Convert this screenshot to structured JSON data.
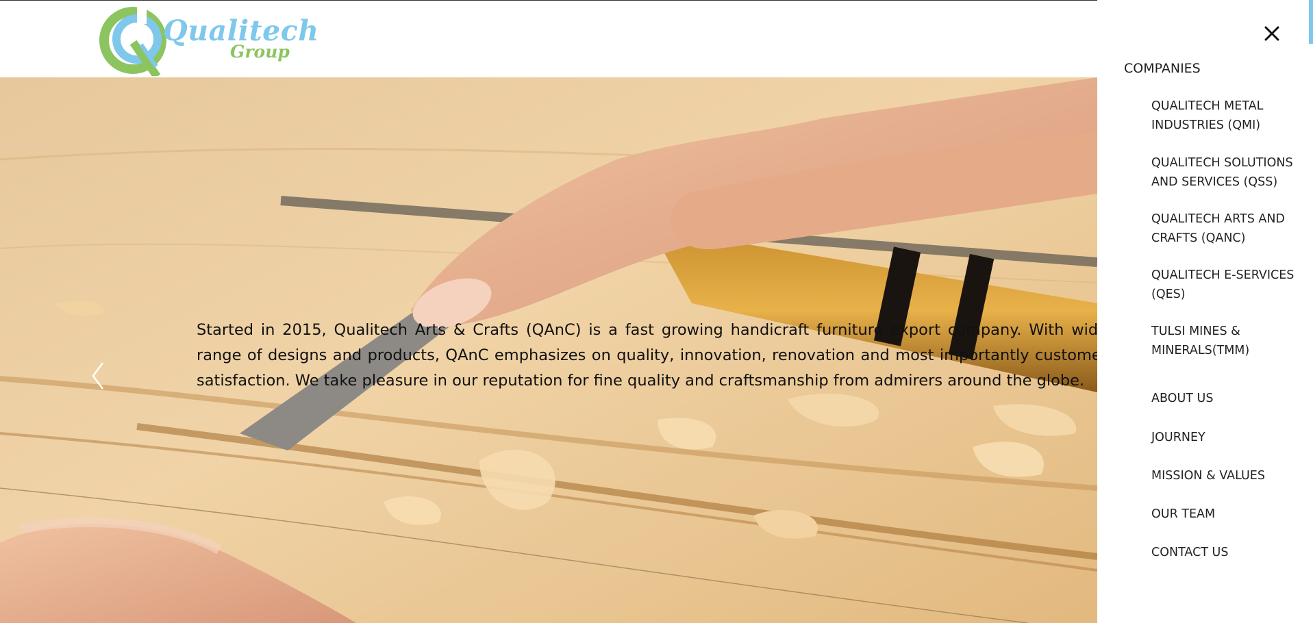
{
  "header": {
    "logo": {
      "name": "Qualitech",
      "sub": "Group",
      "mark_icon": "qualitech-q-logo",
      "colors": {
        "blue": "#7fc8ec",
        "green": "#8cc45f"
      }
    }
  },
  "hero": {
    "description": "Started in 2015, Qualitech Arts & Crafts (QAnC) is a fast growing handicraft furniture export company. With wide range of designs and products, QAnC emphasizes on quality, innovation, renovation and most importantly customer satisfaction. We take pleasure in our reputation for fine quality and craftsmanship from admirers around the globe.",
    "background_image": "wood-carving-chisel-photo",
    "prev_icon": "chevron-left-icon"
  },
  "menu": {
    "close_icon": "close-icon",
    "heading": "COMPANIES",
    "companies": [
      {
        "label": "QUALITECH METAL INDUSTRIES (QMI)"
      },
      {
        "label": "QUALITECH SOLUTIONS AND SERVICES (QSS)"
      },
      {
        "label": "QUALITECH ARTS AND CRAFTS (QANC)"
      },
      {
        "label": "QUALITECH E-SERVICES (QES)"
      },
      {
        "label": "TULSI MINES & MINERALS(TMM)"
      }
    ],
    "links": [
      {
        "label": "ABOUT US"
      },
      {
        "label": "JOURNEY"
      },
      {
        "label": "MISSION & VALUES"
      },
      {
        "label": "OUR TEAM"
      },
      {
        "label": "CONTACT US"
      }
    ]
  }
}
